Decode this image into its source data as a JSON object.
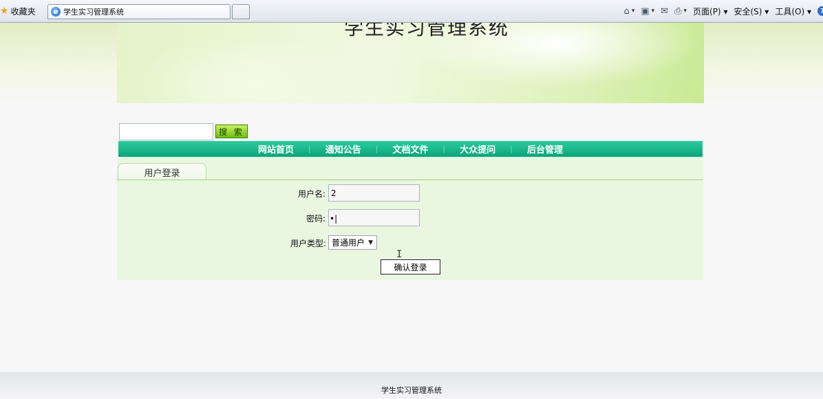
{
  "browser": {
    "favorites_label": "收藏夹",
    "tab_title": "学生实习管理系统",
    "menu_page": "页面(P)",
    "menu_safety": "安全(S)",
    "menu_tools": "工具(O)",
    "menu_arrow": "▾"
  },
  "site": {
    "title": "学生实习管理系统"
  },
  "search": {
    "value": "",
    "button_label": "搜 索"
  },
  "nav": {
    "items": [
      {
        "label": "网站首页"
      },
      {
        "label": "通知公告"
      },
      {
        "label": "文档文件"
      },
      {
        "label": "大众提问"
      },
      {
        "label": "后台管理"
      }
    ],
    "separator": "|"
  },
  "login": {
    "tab_label": "用户登录",
    "username_label": "用户名:",
    "username_value": "2",
    "password_label": "密码:",
    "password_mask": "•|",
    "usertype_label": "用户类型:",
    "usertype_selected": "普通用户",
    "confirm_label": "确认登录"
  },
  "footer": {
    "text": "学生实习管理系统"
  },
  "colors": {
    "nav_bg": "#0aa57a",
    "panel_bg": "#e9f7e0",
    "search_button": "#6fbf12"
  },
  "icons": [
    "star-icon",
    "ie-icon",
    "home-icon",
    "rss-icon",
    "mail-icon",
    "print-icon",
    "help-icon",
    "chevron-down-icon",
    "text-cursor-icon"
  ]
}
